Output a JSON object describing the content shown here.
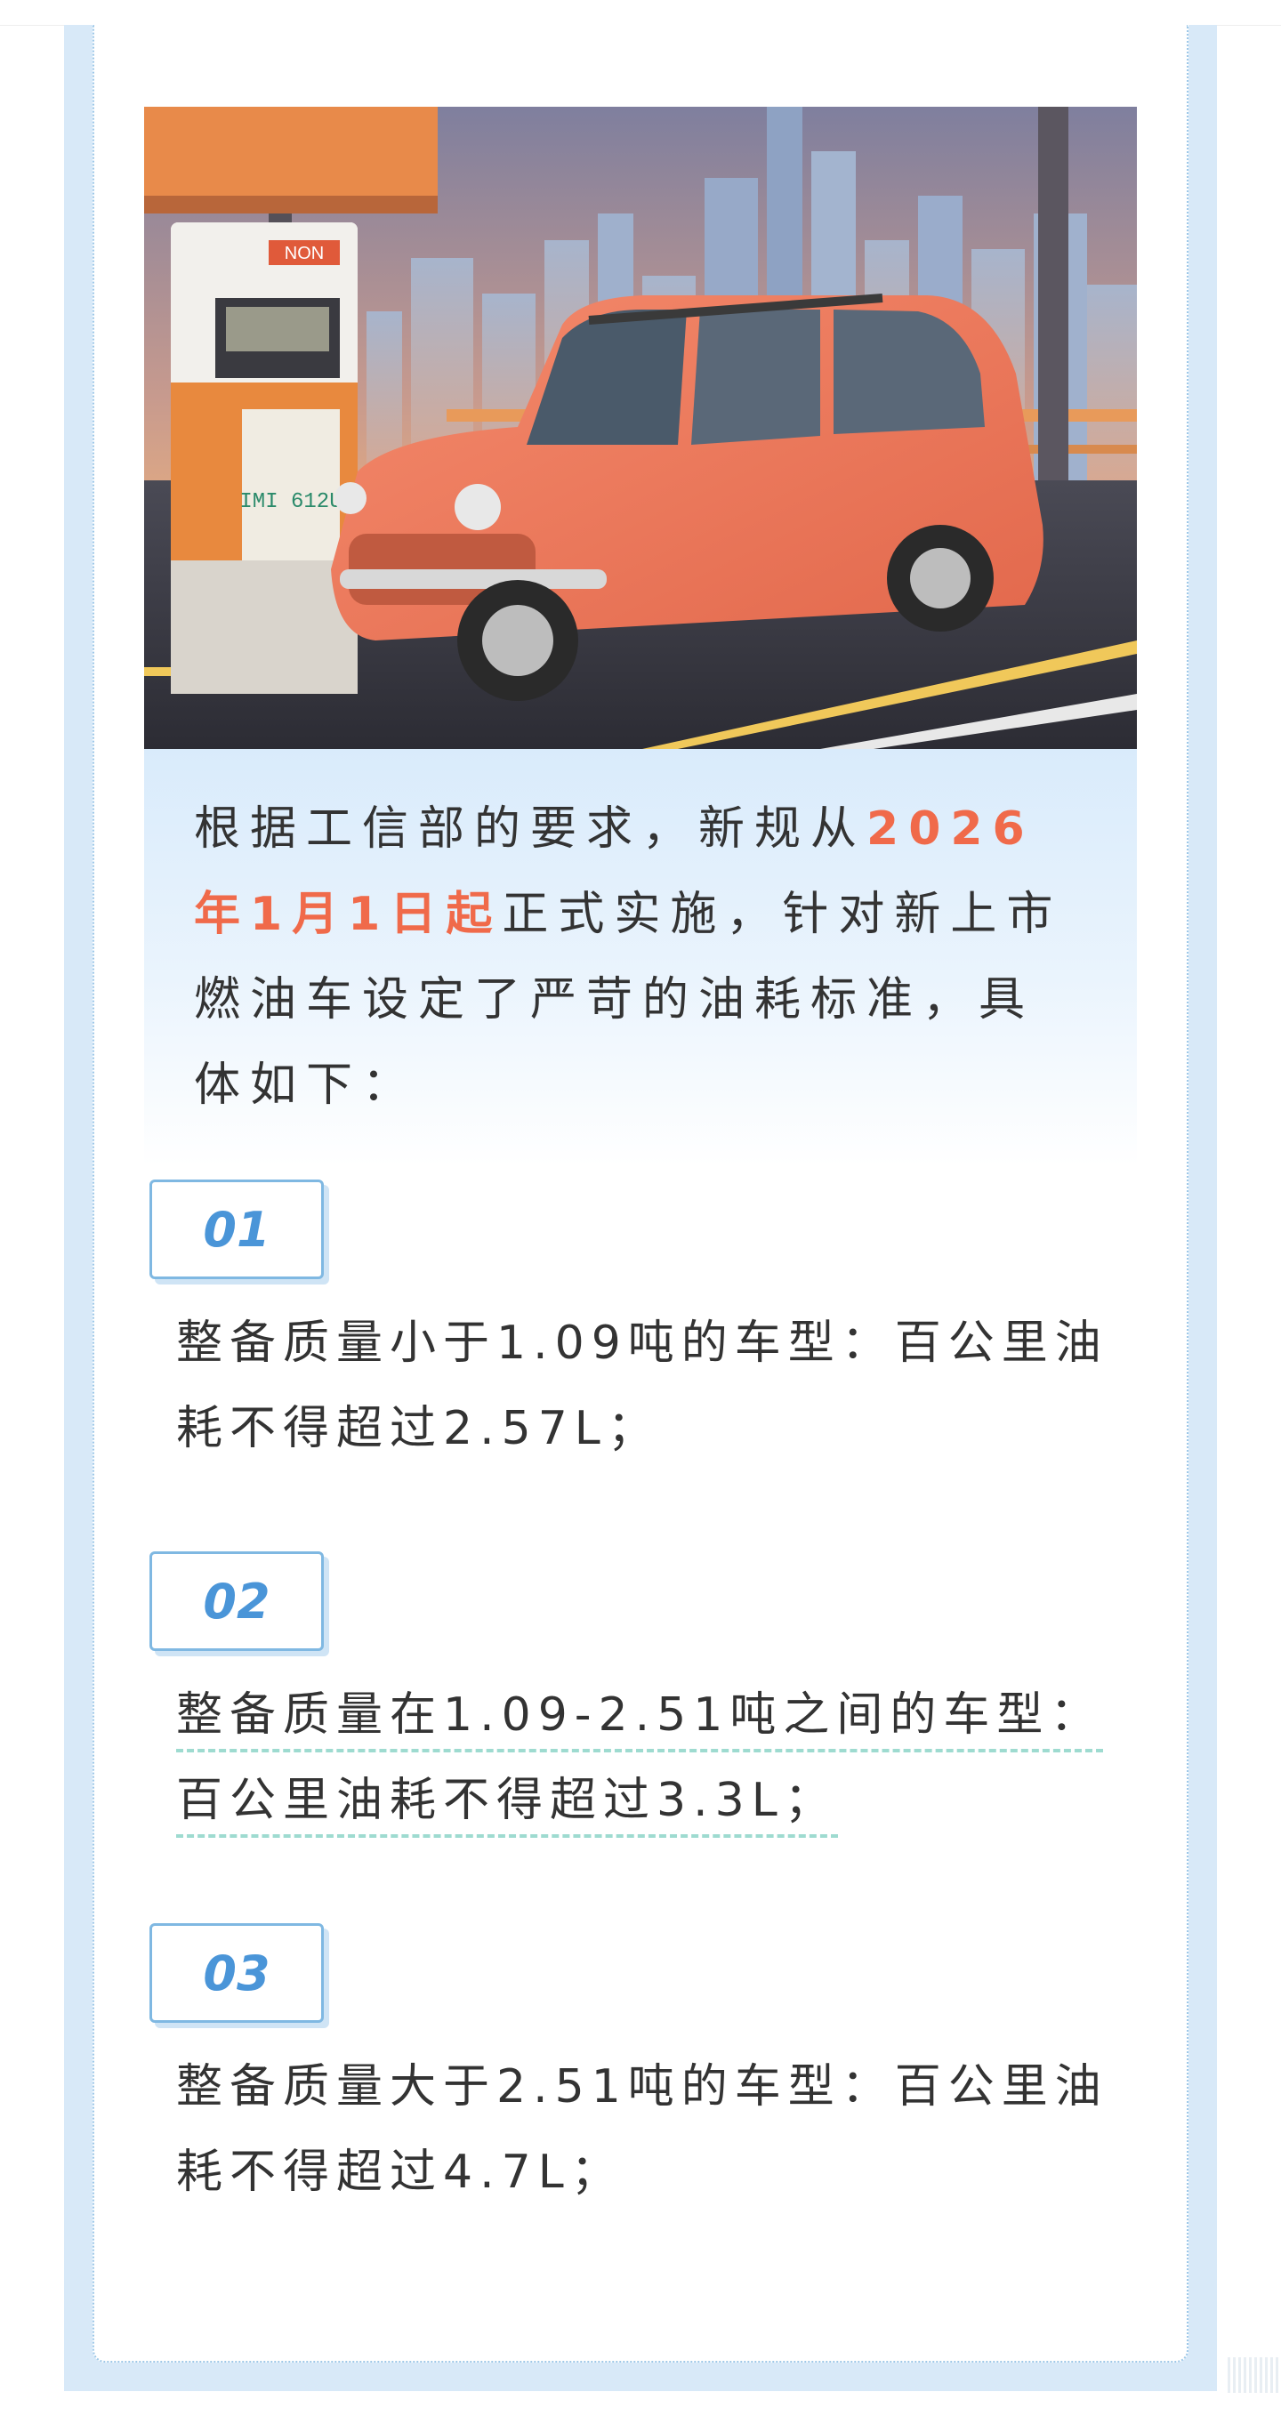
{
  "intro": {
    "before": "根据工信部的要求，新规从",
    "highlight": "2026年1月1日起",
    "after": "正式实施，针对新上市燃油车设定了严苛的油耗标准，具体如下："
  },
  "items": [
    {
      "number": "01",
      "text": "整备质量小于1.09吨的车型：百公里油耗不得超过2.57L；"
    },
    {
      "number": "02",
      "line1": "整备质量在1.09-2.51吨之间的车型：",
      "line2": "百公里油耗不得超过3.3L；"
    },
    {
      "number": "03",
      "text": "整备质量大于2.51吨的车型：百公里油耗不得超过4.7L；"
    }
  ],
  "hero_image": {
    "pump_sign": "NON",
    "pump_display": "IMI 612U"
  },
  "colors": {
    "highlight": "#f06a4a",
    "accent": "#4a95d8",
    "frame": "#d8e9f8",
    "dashed_underline": "#9edbd0"
  }
}
